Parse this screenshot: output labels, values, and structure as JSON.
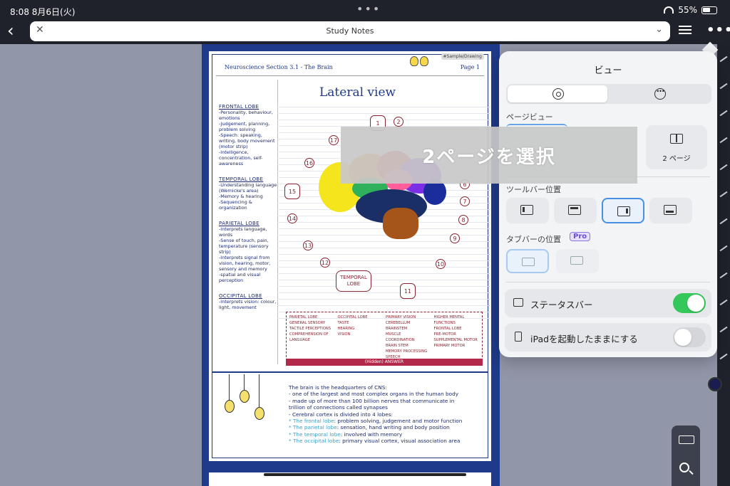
{
  "status_bar": {
    "time": "8:08",
    "date": "8月6日(火)",
    "battery": "55%"
  },
  "nav": {
    "title": "Study Notes"
  },
  "document": {
    "tag": "#Sample/Drawing",
    "section": "Neuroscience Section 3.1 - The Brain",
    "page_label": "Page 1",
    "diagram_title": "Lateral view",
    "left_notes": [
      {
        "heading": "FRONTAL LOBE",
        "lines": [
          "-Personality, behaviour, emotions",
          "-Judgement, planning, problem solving",
          "-Speech: speaking, writing, body movement (motor strip)",
          "-Intelligence, concentration, self-awareness"
        ]
      },
      {
        "heading": "TEMPORAL LOBE",
        "lines": [
          "-Understanding language (Wernicke's area)",
          "-Memory & hearing",
          "-Sequencing & organization"
        ]
      },
      {
        "heading": "PARIETAL LOBE",
        "lines": [
          "-Interprets language, words",
          "-Sense of touch, pain, temperature (sensory strip)",
          "-Interprets signal from vision, hearing, motor, sensory and memory",
          "-spatial and visual perception"
        ]
      },
      {
        "heading": "OCCIPITAL LOBE",
        "lines": [
          "-Interprets vision: colour, light, movement"
        ]
      }
    ],
    "diagram_numbers": [
      "1",
      "2",
      "17",
      "16",
      "15",
      "14",
      "13",
      "12",
      "11",
      "10",
      "9",
      "8",
      "7",
      "6"
    ],
    "temporal_label": "TEMPORAL LOBE",
    "legend": [
      [
        "PARIETAL LOBE",
        "GENERAL SENSORY",
        "TACTILE PERCEPTIONS",
        "COMPREHENSION OF LANGUAGE"
      ],
      [
        "OCCIPITAL LOBE",
        "TASTE",
        "HEARING",
        "VISION"
      ],
      [
        "PRIMARY VISION",
        "CEREBELLUM BRAINSTEM",
        "MUSCLE COORDINATION",
        "BRAIN STEM",
        "MEMORY PROCESSING",
        "SPEECH"
      ],
      [
        "HIGHER MENTAL FUNCTIONS",
        "FRONTAL LOBE",
        "PRE-MOTOR",
        "SUPPLEMENTAL MOTOR",
        "PRIMARY MOTOR"
      ]
    ],
    "legend_answer": "(Hidden) ANSWER",
    "notes": [
      "The brain is the headquarters of CNS:",
      "- one of the largest and most complex organs in the human body",
      "- made up of more than 100 billion nerves that communicate in",
      "  trillion of connections called synapses",
      "- Cerebral cortex is divided into 4 lobes:"
    ],
    "lobe_notes": [
      {
        "name": "* The frontal lobe",
        "desc": ": problem solving, judgement and motor function"
      },
      {
        "name": "* The parietal lobe",
        "desc": ": sensation, hand writing and body position"
      },
      {
        "name": "* The temporal lobe",
        "desc": ": involved with memory"
      },
      {
        "name": "* The occipital lobe",
        "desc": ": primary visual cortex, visual association area"
      }
    ]
  },
  "banner": {
    "text": "2ページを選択"
  },
  "popover": {
    "title": "ビュー",
    "page_view_label": "ページビュー",
    "two_page_label": "2 ページ",
    "toolbar_position_label": "ツールバー位置",
    "tabbar_position_label": "タブバーの位置",
    "pro_badge": "Pro",
    "status_bar_label": "ステータスバー",
    "status_bar_on": true,
    "keep_awake_label": "iPadを起動したままにする",
    "keep_awake_on": false
  },
  "colors": {
    "accent": "#4a90e2",
    "toggle_on": "#34c759",
    "page_border": "#1f3a8a",
    "legend_answer": "#b2294b",
    "pen_color": "#1b1d4e"
  }
}
